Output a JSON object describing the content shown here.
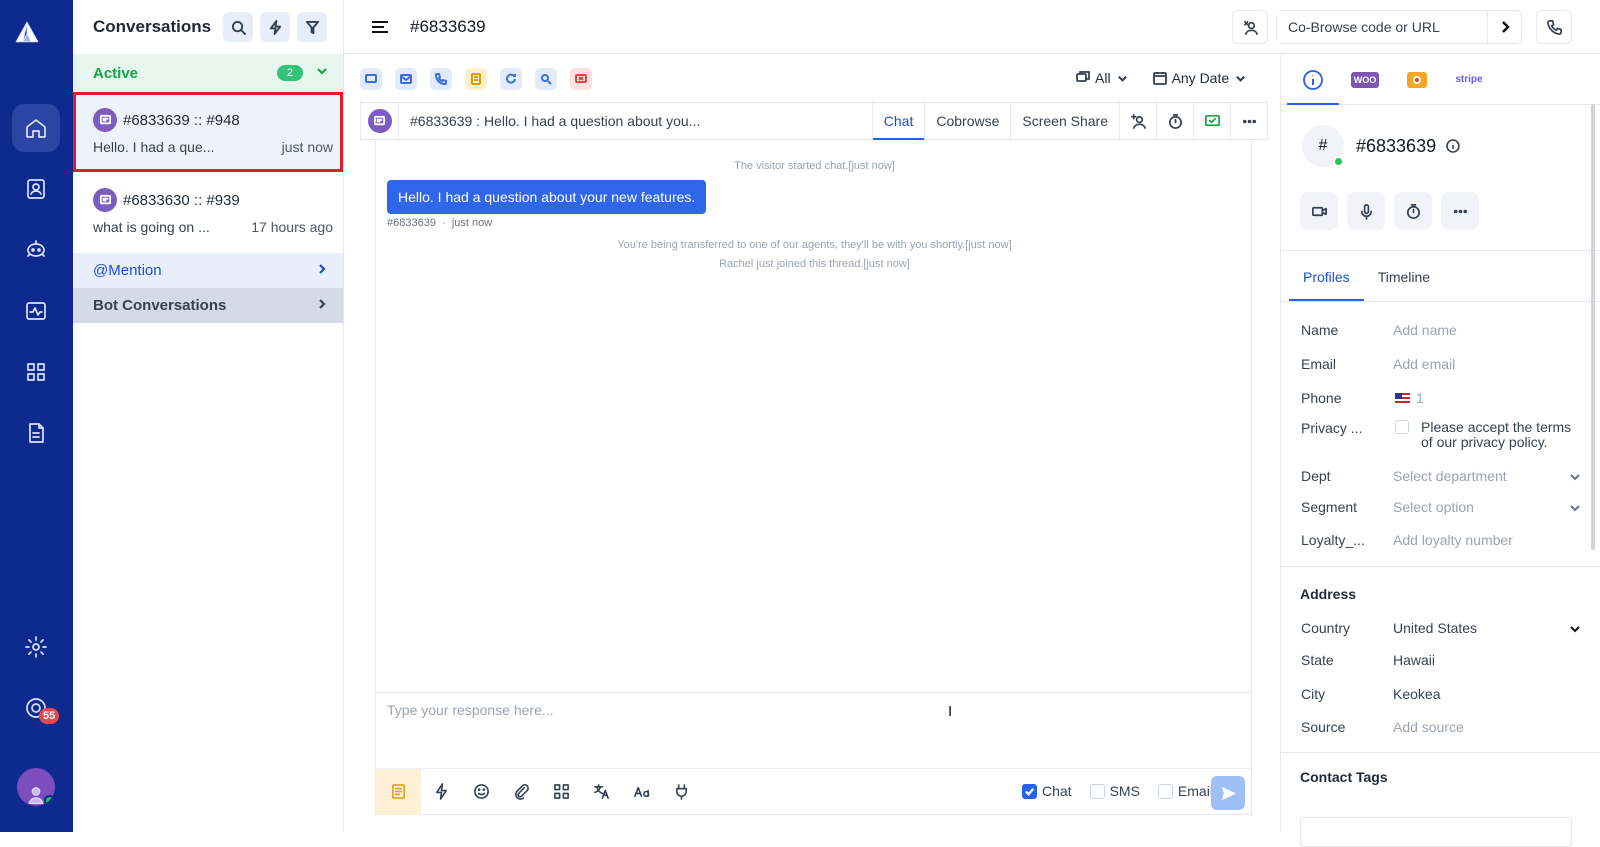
{
  "rail": {
    "badge": "55"
  },
  "conversations": {
    "title": "Conversations",
    "active_label": "Active",
    "active_count": "2",
    "items": [
      {
        "title": "#6833639 :: #948",
        "preview": "Hello. I had a que...",
        "time": "just now"
      },
      {
        "title": "#6833630 :: #939",
        "preview": "what is going on ...",
        "time": "17 hours ago"
      }
    ],
    "mention_label": "@Mention",
    "bot_label": "Bot Conversations"
  },
  "topbar": {
    "title": "#6833639",
    "cobrowse_placeholder": "Co-Browse code or URL"
  },
  "filters": {
    "channel": "All",
    "date": "Any Date"
  },
  "thread": {
    "subject": "#6833639  : Hello. I had a question about you...",
    "tabs": [
      "Chat",
      "Cobrowse",
      "Screen Share"
    ],
    "sys1": "The visitor started chat.[just now]",
    "message": "Hello. I had a question about your new features.",
    "msg_sender": "#6833639",
    "msg_time": "just now",
    "sys2": "You're being transferred to one of our agents, they'll be with you shortly.[just now]",
    "sys3": "Rachel just joined this thread.[just now]"
  },
  "composer": {
    "placeholder": "Type your response here...",
    "channels": [
      {
        "label": "Chat",
        "checked": true
      },
      {
        "label": "SMS",
        "checked": false
      },
      {
        "label": "Email",
        "checked": false
      }
    ],
    "icons": [
      "notes-icon",
      "lightning-icon",
      "emoji-icon",
      "paperclip-icon",
      "apps-icon",
      "translate-icon",
      "font-icon",
      "plug-icon"
    ]
  },
  "contact": {
    "avatar_char": "#",
    "name": "#6833639",
    "tabs": [
      "Profiles",
      "Timeline"
    ],
    "fields": {
      "name": {
        "k": "Name",
        "v": "Add name"
      },
      "email": {
        "k": "Email",
        "v": "Add email"
      },
      "phone": {
        "k": "Phone",
        "v": "1"
      },
      "privacy": {
        "k": "Privacy ...",
        "v": "Please accept the terms of our privacy policy."
      },
      "dept": {
        "k": "Dept",
        "v": "Select department"
      },
      "segment": {
        "k": "Segment",
        "v": "Select option"
      },
      "loyalty": {
        "k": "Loyalty_...",
        "v": "Add loyalty number"
      }
    },
    "address_title": "Address",
    "address": {
      "country": {
        "k": "Country",
        "v": "United States"
      },
      "state": {
        "k": "State",
        "v": "Hawaii"
      },
      "city": {
        "k": "City",
        "v": "Keokea"
      },
      "source": {
        "k": "Source",
        "v": "Add source"
      }
    },
    "tags_title": "Contact Tags",
    "integrations": {
      "woo": "WOO",
      "stripe": "stripe"
    }
  },
  "colors": {
    "rail": "#0f2a8f",
    "accent": "#2563eb",
    "active_green": "#34c27a",
    "selection": "#e11d2c"
  }
}
